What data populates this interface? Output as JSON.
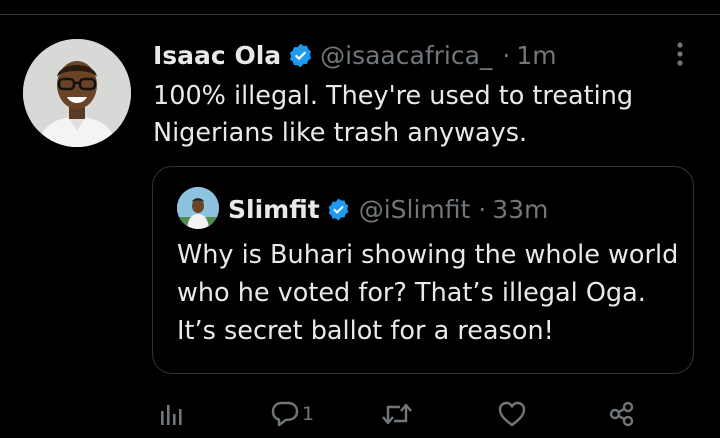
{
  "tweet": {
    "author": {
      "name": "Isaac Ola",
      "handle": "@isaacafrica_",
      "verified": true,
      "avatar": "avatar-photo"
    },
    "separator": "·",
    "time": "1m",
    "text": "100% illegal. They're used to treating Nigerians like trash anyways.",
    "menu_icon": "more-vertical-icon"
  },
  "quoted_tweet": {
    "author": {
      "name": "Slimfit",
      "handle": "@iSlimfit",
      "verified": true,
      "avatar": "avatar-photo"
    },
    "separator": "·",
    "time": "33m",
    "text": "Why is Buhari showing the whole world who he voted for? That’s illegal Oga. It’s secret ballot for a reason!"
  },
  "actions": {
    "analytics_icon": "analytics-icon",
    "reply_icon": "reply-icon",
    "reply_count": "1",
    "retweet_icon": "retweet-icon",
    "like_icon": "heart-icon",
    "share_icon": "share-icon"
  },
  "colors": {
    "background": "#000000",
    "text_primary": "#e7e9ea",
    "text_secondary": "#71767b",
    "border": "#2f3336",
    "verified_blue": "#1d9bf0"
  }
}
